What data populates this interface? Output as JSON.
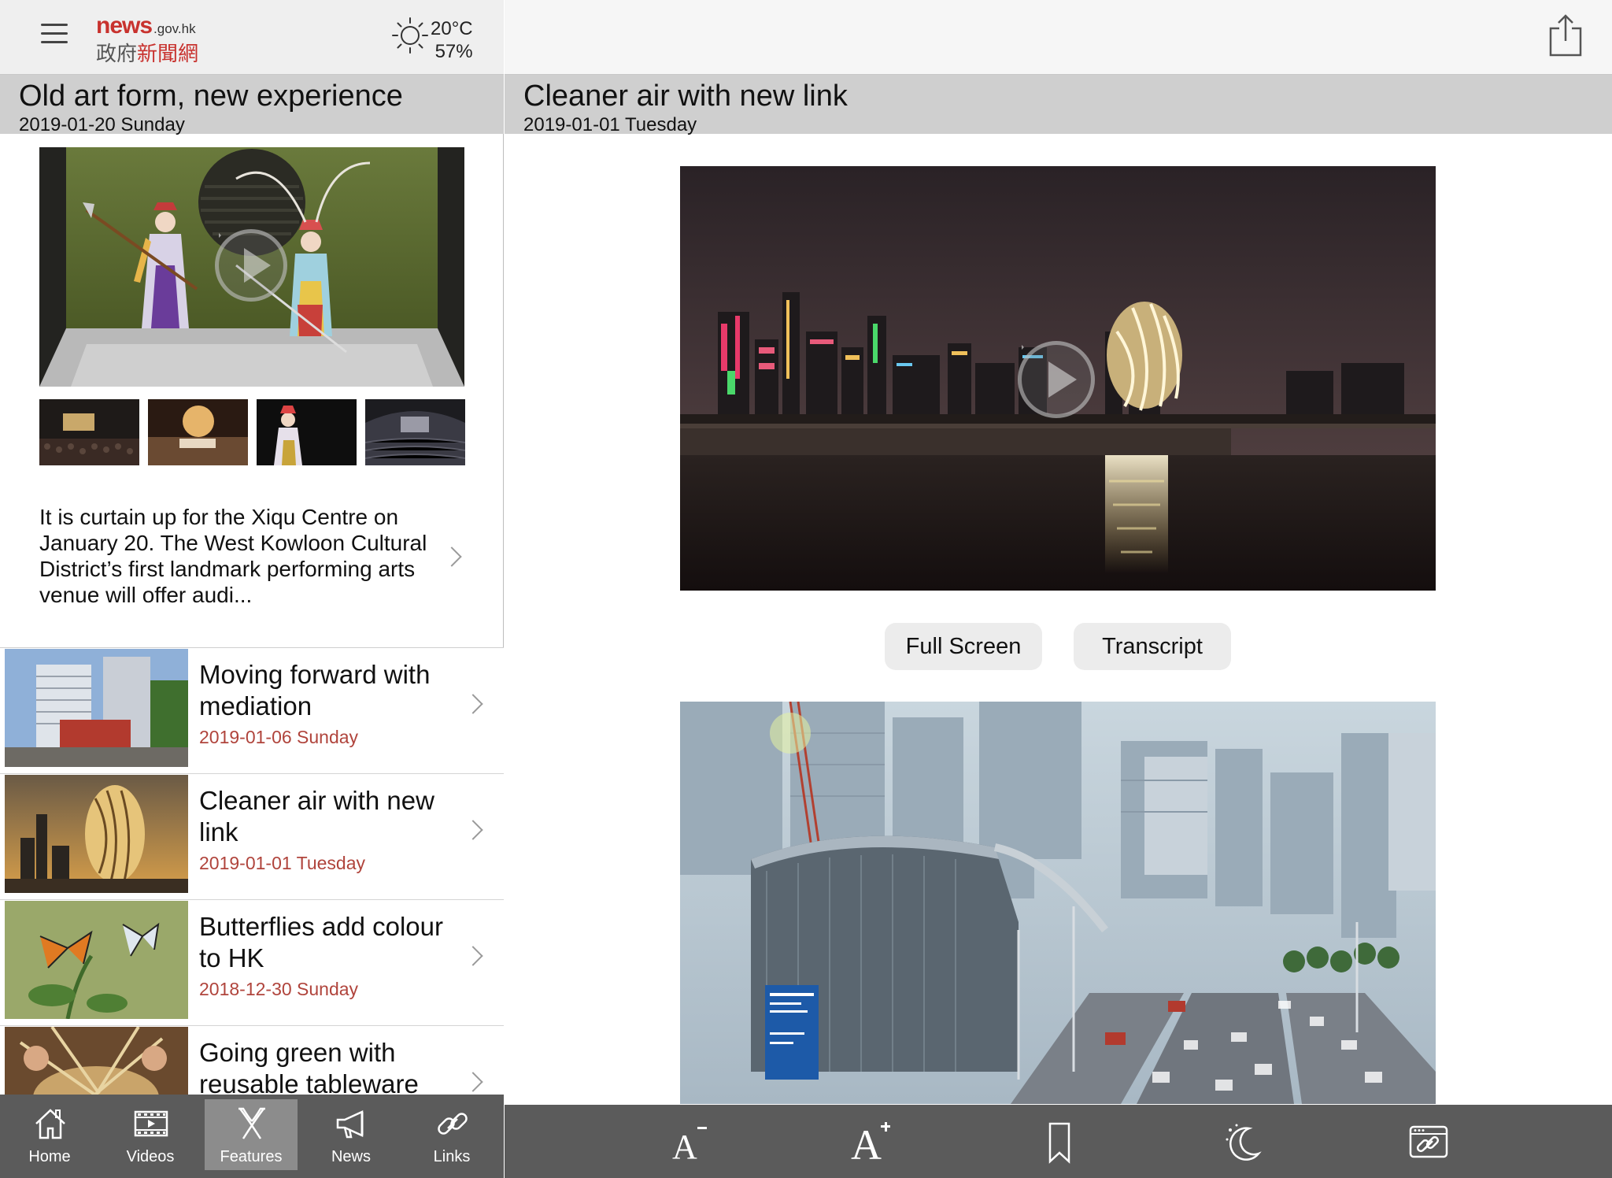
{
  "app": {
    "logo_news": "news",
    "logo_domain": ".gov.hk",
    "logo_chinese_grey": "政府",
    "logo_chinese_red": "新聞網",
    "brand_color": "#c8322e"
  },
  "weather": {
    "icon": "sun-icon",
    "temperature": "20°C",
    "humidity": "57%"
  },
  "feature": {
    "title": "Old art form, new experience",
    "date": "2019-01-20 Sunday",
    "summary": "It is curtain up for the Xiqu Centre on January 20. The West Kowloon Cultural District’s first landmark performing arts venue will offer audi...",
    "thumbnail_count": 4
  },
  "list": {
    "date_color": "#b0443c",
    "items": [
      {
        "title": "Moving forward with mediation",
        "date": "2019-01-06 Sunday"
      },
      {
        "title": "Cleaner air with new link",
        "date": "2019-01-01 Tuesday"
      },
      {
        "title": "Butterflies add colour to HK",
        "date": "2018-12-30 Sunday"
      },
      {
        "title": "Going green with reusable tableware",
        "date": ""
      }
    ]
  },
  "tabs": [
    {
      "label": "Home",
      "icon": "home-icon",
      "active": false
    },
    {
      "label": "Videos",
      "icon": "videos-icon",
      "active": false
    },
    {
      "label": "Features",
      "icon": "features-icon",
      "active": true
    },
    {
      "label": "News",
      "icon": "megaphone-icon",
      "active": false
    },
    {
      "label": "Links",
      "icon": "link-icon",
      "active": false
    }
  ],
  "article": {
    "title": "Cleaner air with new link",
    "date": "2019-01-01 Tuesday",
    "fullscreen_label": "Full Screen",
    "transcript_label": "Transcript"
  },
  "toolbar": {
    "decrease_font": "A",
    "increase_font": "A",
    "items": [
      "decrease-font-icon",
      "increase-font-icon",
      "bookmark-icon",
      "night-mode-icon",
      "open-in-browser-icon"
    ]
  },
  "colors": {
    "header_bg": "#efefef",
    "headline_bar_bg": "#cfcfcf",
    "tabbar_bg": "#5b5b5b",
    "active_tab_bg": "#8c8c8c"
  }
}
